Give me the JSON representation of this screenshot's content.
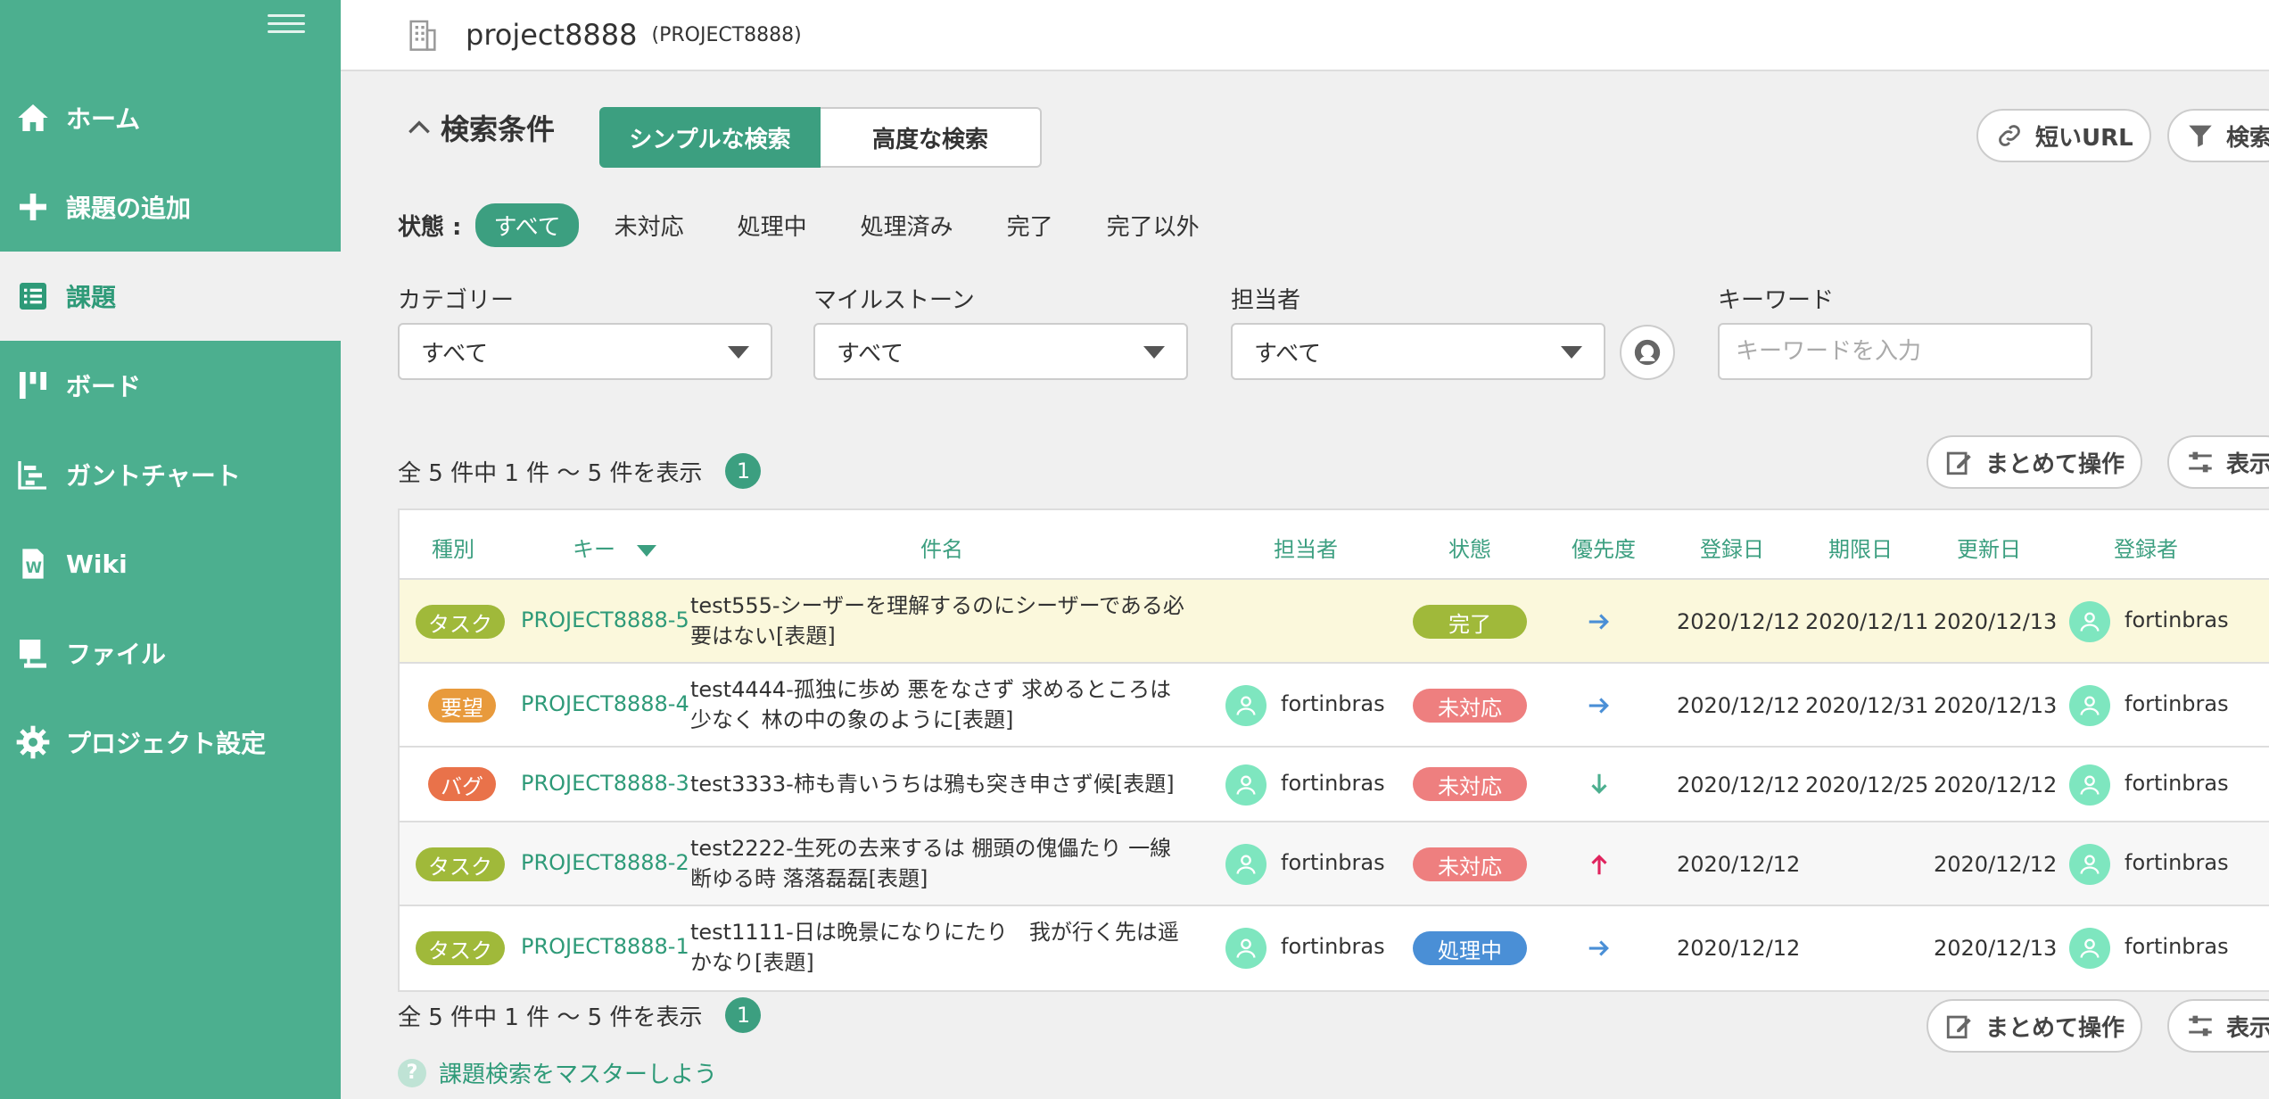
{
  "sidebar": {
    "items": [
      {
        "label": "ホーム",
        "icon": "home-icon"
      },
      {
        "label": "課題の追加",
        "icon": "plus-icon"
      },
      {
        "label": "課題",
        "icon": "list-icon",
        "active": true
      },
      {
        "label": "ボード",
        "icon": "board-icon"
      },
      {
        "label": "ガントチャート",
        "icon": "gantt-icon"
      },
      {
        "label": "Wiki",
        "icon": "wiki-icon"
      },
      {
        "label": "ファイル",
        "icon": "file-icon"
      },
      {
        "label": "プロジェクト設定",
        "icon": "gear-icon"
      }
    ]
  },
  "header": {
    "project_name": "project8888",
    "project_key": "(PROJECT8888)"
  },
  "search": {
    "title": "検索条件",
    "tab_simple": "シンプルな検索",
    "tab_advanced": "高度な検索",
    "short_url": "短いURL",
    "filter_btn": "検索"
  },
  "status_filter": {
    "label": "状態 :",
    "options": [
      "すべて",
      "未対応",
      "処理中",
      "処理済み",
      "完了",
      "完了以外"
    ],
    "selected": "すべて"
  },
  "filters": {
    "category_label": "カテゴリー",
    "category_value": "すべて",
    "milestone_label": "マイルストーン",
    "milestone_value": "すべて",
    "assignee_label": "担当者",
    "assignee_value": "すべて",
    "keyword_label": "キーワード",
    "keyword_placeholder": "キーワードを入力"
  },
  "summary": {
    "text": "全 5 件中 1 件 〜 5 件を表示",
    "page": "1"
  },
  "actions": {
    "bulk": "まとめて操作",
    "display": "表示"
  },
  "table": {
    "columns": [
      "種別",
      "キー",
      "件名",
      "担当者",
      "状態",
      "優先度",
      "登録日",
      "期限日",
      "更新日",
      "登録者"
    ],
    "rows": [
      {
        "type": "タスク",
        "type_color": "#a0b93a",
        "key": "PROJECT8888-5",
        "subject": "test555-シーザーを理解するのにシーザーである必要はない[表題]",
        "assignee": "",
        "status": "完了",
        "status_color": "#a0b93a",
        "priority": "right-arrow-icon",
        "created": "2020/12/12",
        "due": "2020/12/11",
        "updated": "2020/12/13",
        "creator": "fortinbras"
      },
      {
        "type": "要望",
        "type_color": "#e89a3c",
        "key": "PROJECT8888-4",
        "subject": "test4444-孤独に歩め 悪をなさず 求めるところは少なく 林の中の象のように[表題]",
        "assignee": "fortinbras",
        "status": "未対応",
        "status_color": "#ee7f7f",
        "priority": "right-arrow-icon",
        "created": "2020/12/12",
        "due": "2020/12/31",
        "updated": "2020/12/13",
        "creator": "fortinbras"
      },
      {
        "type": "バグ",
        "type_color": "#e9724a",
        "key": "PROJECT8888-3",
        "subject": "test3333-柿も青いうちは鴉も突き申さず候[表題]",
        "assignee": "fortinbras",
        "status": "未対応",
        "status_color": "#ee7f7f",
        "priority": "down-arrow-icon",
        "created": "2020/12/12",
        "due": "2020/12/25",
        "updated": "2020/12/12",
        "creator": "fortinbras"
      },
      {
        "type": "タスク",
        "type_color": "#a0b93a",
        "key": "PROJECT8888-2",
        "subject": "test2222-生死の去来するは 棚頭の傀儡たり 一線断ゆる時 落落磊磊[表題]",
        "assignee": "fortinbras",
        "status": "未対応",
        "status_color": "#ee7f7f",
        "priority": "up-arrow-icon",
        "created": "2020/12/12",
        "due": "",
        "updated": "2020/12/12",
        "creator": "fortinbras"
      },
      {
        "type": "タスク",
        "type_color": "#a0b93a",
        "key": "PROJECT8888-1",
        "subject": "test1111-日は晩景になりにたり　我が行く先は遥かなり[表題]",
        "assignee": "fortinbras",
        "status": "処理中",
        "status_color": "#4a8fd6",
        "priority": "right-arrow-icon",
        "created": "2020/12/12",
        "due": "",
        "updated": "2020/12/13",
        "creator": "fortinbras"
      }
    ]
  },
  "help_link": "課題検索をマスターしよう",
  "colors": {
    "brand": "#4caf8f",
    "accent": "#3c9f80"
  }
}
